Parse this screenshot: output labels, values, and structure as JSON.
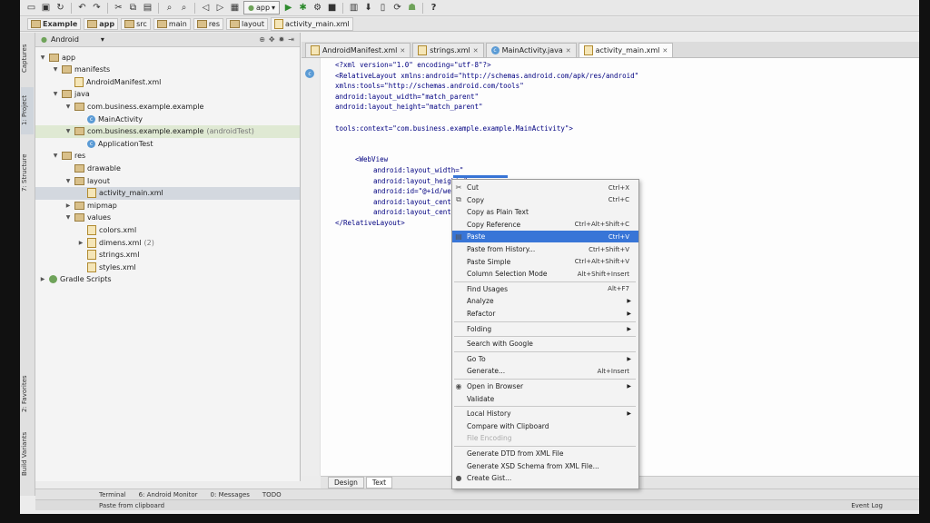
{
  "toolbar": {
    "run_config": "app",
    "help": "?"
  },
  "breadcrumb": [
    "Example",
    "app",
    "src",
    "main",
    "res",
    "layout",
    "activity_main.xml"
  ],
  "project_panel": {
    "view_mode": "Android",
    "tree": [
      {
        "label": "app",
        "level": 0,
        "kind": "folder",
        "expanded": true
      },
      {
        "label": "manifests",
        "level": 1,
        "kind": "folder",
        "expanded": true
      },
      {
        "label": "AndroidManifest.xml",
        "level": 2,
        "kind": "xml"
      },
      {
        "label": "java",
        "level": 1,
        "kind": "folder",
        "expanded": true
      },
      {
        "label": "com.business.example.example",
        "level": 2,
        "kind": "folder",
        "expanded": true
      },
      {
        "label": "MainActivity",
        "level": 3,
        "kind": "class"
      },
      {
        "label": "com.business.example.example",
        "suffix": "(androidTest)",
        "level": 2,
        "kind": "folder",
        "expanded": true
      },
      {
        "label": "ApplicationTest",
        "level": 3,
        "kind": "class"
      },
      {
        "label": "res",
        "level": 1,
        "kind": "folder",
        "expanded": true
      },
      {
        "label": "drawable",
        "level": 2,
        "kind": "folder"
      },
      {
        "label": "layout",
        "level": 2,
        "kind": "folder",
        "expanded": true
      },
      {
        "label": "activity_main.xml",
        "level": 3,
        "kind": "xml",
        "selected": true
      },
      {
        "label": "mipmap",
        "level": 2,
        "kind": "folder",
        "collapsed": true
      },
      {
        "label": "values",
        "level": 2,
        "kind": "folder",
        "expanded": true
      },
      {
        "label": "colors.xml",
        "level": 3,
        "kind": "xml"
      },
      {
        "label": "dimens.xml",
        "suffix": "(2)",
        "level": 3,
        "kind": "xml",
        "collapsed": true
      },
      {
        "label": "strings.xml",
        "level": 3,
        "kind": "xml"
      },
      {
        "label": "styles.xml",
        "level": 3,
        "kind": "xml"
      },
      {
        "label": "Gradle Scripts",
        "level": 0,
        "kind": "gradle",
        "collapsed": true
      }
    ]
  },
  "side_tabs": [
    "Captures",
    "1: Project",
    "7: Structure",
    "2: Favorites",
    "Build Variants"
  ],
  "editor_tabs": [
    {
      "label": "AndroidManifest.xml",
      "active": false
    },
    {
      "label": "strings.xml",
      "active": false
    },
    {
      "label": "MainActivity.java",
      "active": false
    },
    {
      "label": "activity_main.xml",
      "active": true
    }
  ],
  "code_lines": [
    "<?xml version=\"1.0\" encoding=\"utf-8\"?>",
    "<RelativeLayout xmlns:android=\"http://schemas.android.com/apk/res/android\"",
    "    xmlns:tools=\"http://schemas.android.com/tools\"",
    "    android:layout_width=\"match_parent\"",
    "    android:layout_height=\"match_parent\"",
    "",
    "    tools:context=\"com.business.example.example.MainActivity\">",
    "",
    "",
    "    <WebView",
    "        android:layout_width=\"",
    "        android:layout_height=\"",
    "        android:id=\"@+id/webVi",
    "        android:layout_centerV",
    "        android:layout_centerH",
    "</RelativeLayout>"
  ],
  "design_tabs": [
    {
      "label": "Design",
      "active": false
    },
    {
      "label": "Text",
      "active": true
    }
  ],
  "context_menu": [
    {
      "label": "Cut",
      "shortcut": "Ctrl+X",
      "icon": "cut-icon"
    },
    {
      "label": "Copy",
      "shortcut": "Ctrl+C",
      "icon": "copy-icon"
    },
    {
      "label": "Copy as Plain Text",
      "shortcut": ""
    },
    {
      "label": "Copy Reference",
      "shortcut": "Ctrl+Alt+Shift+C"
    },
    {
      "label": "Paste",
      "shortcut": "Ctrl+V",
      "icon": "paste-icon",
      "highlighted": true
    },
    {
      "label": "Paste from History...",
      "shortcut": "Ctrl+Shift+V"
    },
    {
      "label": "Paste Simple",
      "shortcut": "Ctrl+Alt+Shift+V"
    },
    {
      "label": "Column Selection Mode",
      "shortcut": "Alt+Shift+Insert"
    },
    {
      "separator": true
    },
    {
      "label": "Find Usages",
      "shortcut": "Alt+F7"
    },
    {
      "label": "Analyze",
      "submenu": true
    },
    {
      "label": "Refactor",
      "submenu": true
    },
    {
      "separator": true
    },
    {
      "label": "Folding",
      "submenu": true
    },
    {
      "separator": true
    },
    {
      "label": "Search with Google",
      "shortcut": ""
    },
    {
      "separator": true
    },
    {
      "label": "Go To",
      "submenu": true
    },
    {
      "label": "Generate...",
      "shortcut": "Alt+Insert"
    },
    {
      "separator": true
    },
    {
      "label": "Open in Browser",
      "submenu": true,
      "icon": "browser-icon"
    },
    {
      "label": "Validate",
      "shortcut": ""
    },
    {
      "separator": true
    },
    {
      "label": "Local History",
      "submenu": true
    },
    {
      "label": "Compare with Clipboard",
      "shortcut": ""
    },
    {
      "label": "File Encoding",
      "shortcut": "",
      "disabled": true
    },
    {
      "separator": true
    },
    {
      "label": "Generate DTD from XML File",
      "shortcut": ""
    },
    {
      "label": "Generate XSD Schema from XML File...",
      "shortcut": ""
    },
    {
      "label": "Create Gist...",
      "shortcut": "",
      "icon": "github-icon"
    }
  ],
  "bottom_tools": [
    "Terminal",
    "6: Android Monitor",
    "0: Messages",
    "TODO"
  ],
  "status": {
    "message": "Paste from clipboard",
    "event_log": "Event Log"
  },
  "colors": {
    "highlight": "#3875d7",
    "xml_tag": "#000080",
    "xml_attr": "#660e7a",
    "xml_string": "#008000"
  }
}
